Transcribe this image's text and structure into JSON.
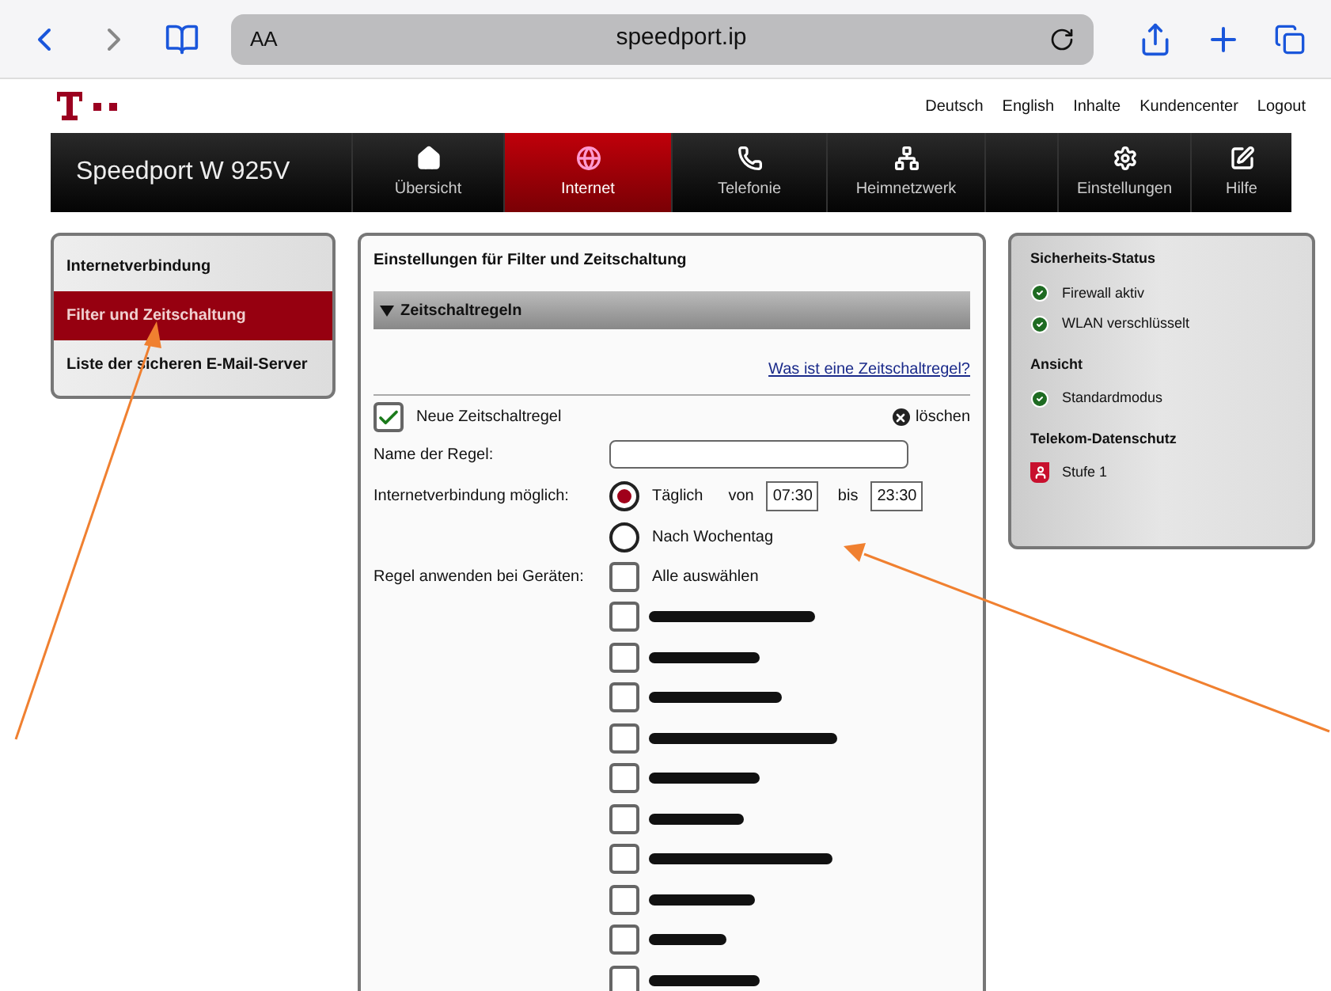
{
  "browser": {
    "text_size_label": "AA",
    "url": "speedport.ip"
  },
  "header_links": [
    "Deutsch",
    "English",
    "Inhalte",
    "Kundencenter",
    "Logout"
  ],
  "nav": {
    "title": "Speedport W 925V",
    "items": [
      {
        "label": "Übersicht",
        "selected": false
      },
      {
        "label": "Internet",
        "selected": true
      },
      {
        "label": "Telefonie",
        "selected": false
      },
      {
        "label": "Heimnetzwerk",
        "selected": false
      }
    ],
    "right_items": [
      {
        "label": "Einstellungen",
        "selected": false
      },
      {
        "label": "Hilfe",
        "selected": false
      }
    ]
  },
  "sidebar": {
    "items": [
      {
        "label": "Internetverbindung",
        "selected": false
      },
      {
        "label": "Filter und Zeitschaltung",
        "selected": true
      },
      {
        "label": "Liste der sicheren E-Mail-Server",
        "selected": false
      }
    ]
  },
  "panel": {
    "title": "Einstellungen für Filter und Zeitschaltung",
    "section": {
      "title": "Zeitschaltregeln",
      "expanded": true
    },
    "help_link": "Was ist eine Zeitschaltregel?",
    "rule": {
      "label": "Neue Zeitschaltregel",
      "checked": true,
      "delete_label": "löschen"
    },
    "name_label": "Name der Regel:",
    "connection": {
      "label": "Internetverbindung möglich:",
      "options": [
        {
          "label": "Täglich",
          "selected": true,
          "from_label": "von",
          "from": "07:30",
          "to_label": "bis",
          "to": "23:30"
        },
        {
          "label": "Nach Wochentag",
          "selected": false
        }
      ]
    },
    "devices": {
      "label": "Regel anwenden bei Geräten:",
      "select_all": {
        "label": "Alle auswählen",
        "checked": false
      },
      "items": [
        {
          "checked": false
        },
        {
          "checked": false
        },
        {
          "checked": false
        },
        {
          "checked": false
        },
        {
          "checked": false
        },
        {
          "checked": false
        },
        {
          "checked": false
        },
        {
          "checked": false
        },
        {
          "checked": false
        },
        {
          "checked": false
        }
      ]
    }
  },
  "status": {
    "sections": [
      {
        "title": "Sicherheits-Status",
        "items": [
          {
            "label": "Firewall aktiv",
            "kind": "ok"
          },
          {
            "label": "WLAN verschlüsselt",
            "kind": "ok"
          }
        ]
      },
      {
        "title": "Ansicht",
        "items": [
          {
            "label": "Standardmodus",
            "kind": "ok"
          }
        ]
      },
      {
        "title": "Telekom-Datenschutz",
        "items": [
          {
            "label": "Stufe 1",
            "kind": "level"
          }
        ]
      }
    ]
  }
}
